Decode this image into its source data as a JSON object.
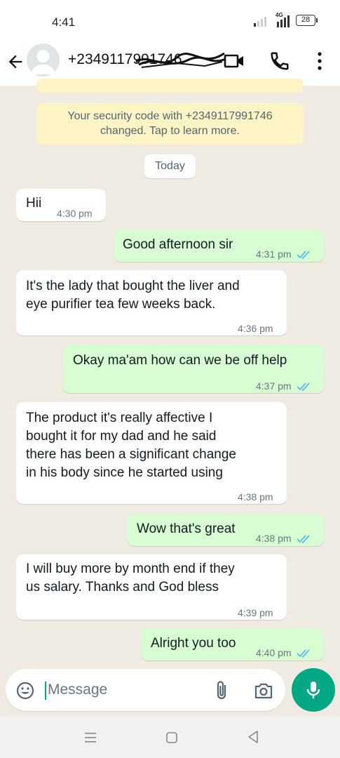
{
  "status_bar": {
    "time": "4:41",
    "network": "4G",
    "battery": "28"
  },
  "header": {
    "contact_name": "+2349117991746"
  },
  "chat": {
    "partial_banner": "",
    "security_banner": {
      "line1": "Your security code with +2349117991746",
      "line2": "changed. Tap to learn more."
    },
    "date_chip": "Today",
    "messages": [
      {
        "direction": "in",
        "lines": [
          "Hii"
        ],
        "time": "4:30 pm"
      },
      {
        "direction": "out",
        "lines": [
          "Good afternoon sir"
        ],
        "time": "4:31 pm",
        "status": "read"
      },
      {
        "direction": "in",
        "lines": [
          "It's the lady that bought the liver and",
          "eye purifier tea few weeks back."
        ],
        "time": "4:36 pm"
      },
      {
        "direction": "out",
        "lines": [
          "Okay ma'am how can we be off help"
        ],
        "time": "4:37 pm",
        "status": "read"
      },
      {
        "direction": "in",
        "lines": [
          "The product it's really affective I",
          "bought it for my dad and he said",
          "there has been a significant change",
          "in his body since he started using"
        ],
        "time": "4:38 pm"
      },
      {
        "direction": "out",
        "lines": [
          "Wow that's great"
        ],
        "time": "4:38 pm",
        "status": "read"
      },
      {
        "direction": "in",
        "lines": [
          "I will buy more by month end if they",
          "us salary. Thanks and God bless"
        ],
        "time": "4:39 pm"
      },
      {
        "direction": "out",
        "lines": [
          "Alright you too"
        ],
        "time": "4:40 pm",
        "status": "read"
      }
    ]
  },
  "composer": {
    "placeholder": "Message"
  },
  "colors": {
    "chat_background": "#efeae2",
    "outgoing_bubble": "#d9fdd3",
    "incoming_bubble": "#ffffff",
    "banner": "#fdf4c5",
    "accent_green": "#00a884",
    "read_ticks": "#53bdeb"
  },
  "icons": [
    "back-arrow-icon",
    "avatar-icon",
    "video-call-icon",
    "phone-icon",
    "more-options-icon",
    "emoji-icon",
    "attach-icon",
    "camera-icon",
    "mic-icon",
    "recent-apps-icon",
    "home-icon",
    "back-triangle-icon"
  ]
}
